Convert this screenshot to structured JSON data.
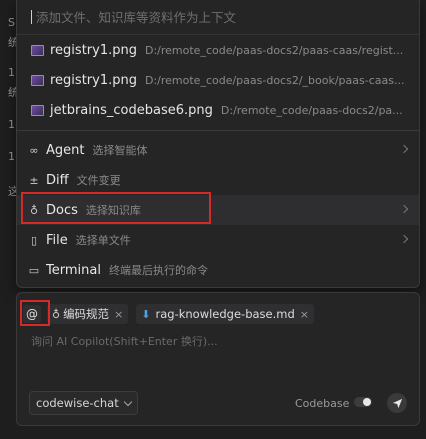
{
  "background": {
    "glyphs": [
      {
        "text": "S"
      },
      {
        "text": "统"
      },
      {
        "text": "1"
      },
      {
        "text": "统"
      },
      {
        "text": "1"
      },
      {
        "text": "1"
      },
      {
        "text": "这"
      }
    ]
  },
  "popup": {
    "search_placeholder": "添加文件、知识库等资料作为上下文",
    "files": [
      {
        "name": "registry1.png",
        "path": "D:/remote_code/paas-docs2/paas-caas/regist..."
      },
      {
        "name": "registry1.png",
        "path": "D:/remote_code/paas-docs2/_book/paas-caas..."
      },
      {
        "name": "jetbrains_codebase6.png",
        "path": "D:/remote_code/paas-docs2/pa..."
      }
    ],
    "commands": [
      {
        "name": "Agent",
        "desc": "选择智能体",
        "icon": "infinity-icon",
        "glyph": "∞"
      },
      {
        "name": "Diff",
        "desc": "文件变更",
        "icon": "diff-icon",
        "glyph": "±"
      },
      {
        "name": "Docs",
        "desc": "选择知识库",
        "icon": "lightbulb-icon",
        "glyph": "♁"
      },
      {
        "name": "File",
        "desc": "选择单文件",
        "icon": "file-icon",
        "glyph": "▯"
      },
      {
        "name": "Terminal",
        "desc": "终端最后执行的命令",
        "icon": "terminal-icon",
        "glyph": "▭"
      }
    ]
  },
  "composer": {
    "at_label": "@",
    "chips": [
      {
        "label": "编码规范",
        "icon": "lightbulb-icon"
      },
      {
        "label": "rag-knowledge-base.md",
        "icon": "markdown-icon"
      }
    ],
    "chip_close": "×",
    "input_placeholder": "询问 AI Copilot(Shift+Enter 换行)...",
    "model": "codewise-chat",
    "codebase_label": "Codebase"
  },
  "colors": {
    "highlight_box": "#d42a2a",
    "image_file_icon": "#a47fd6",
    "markdown_icon": "#4aa3e0"
  }
}
